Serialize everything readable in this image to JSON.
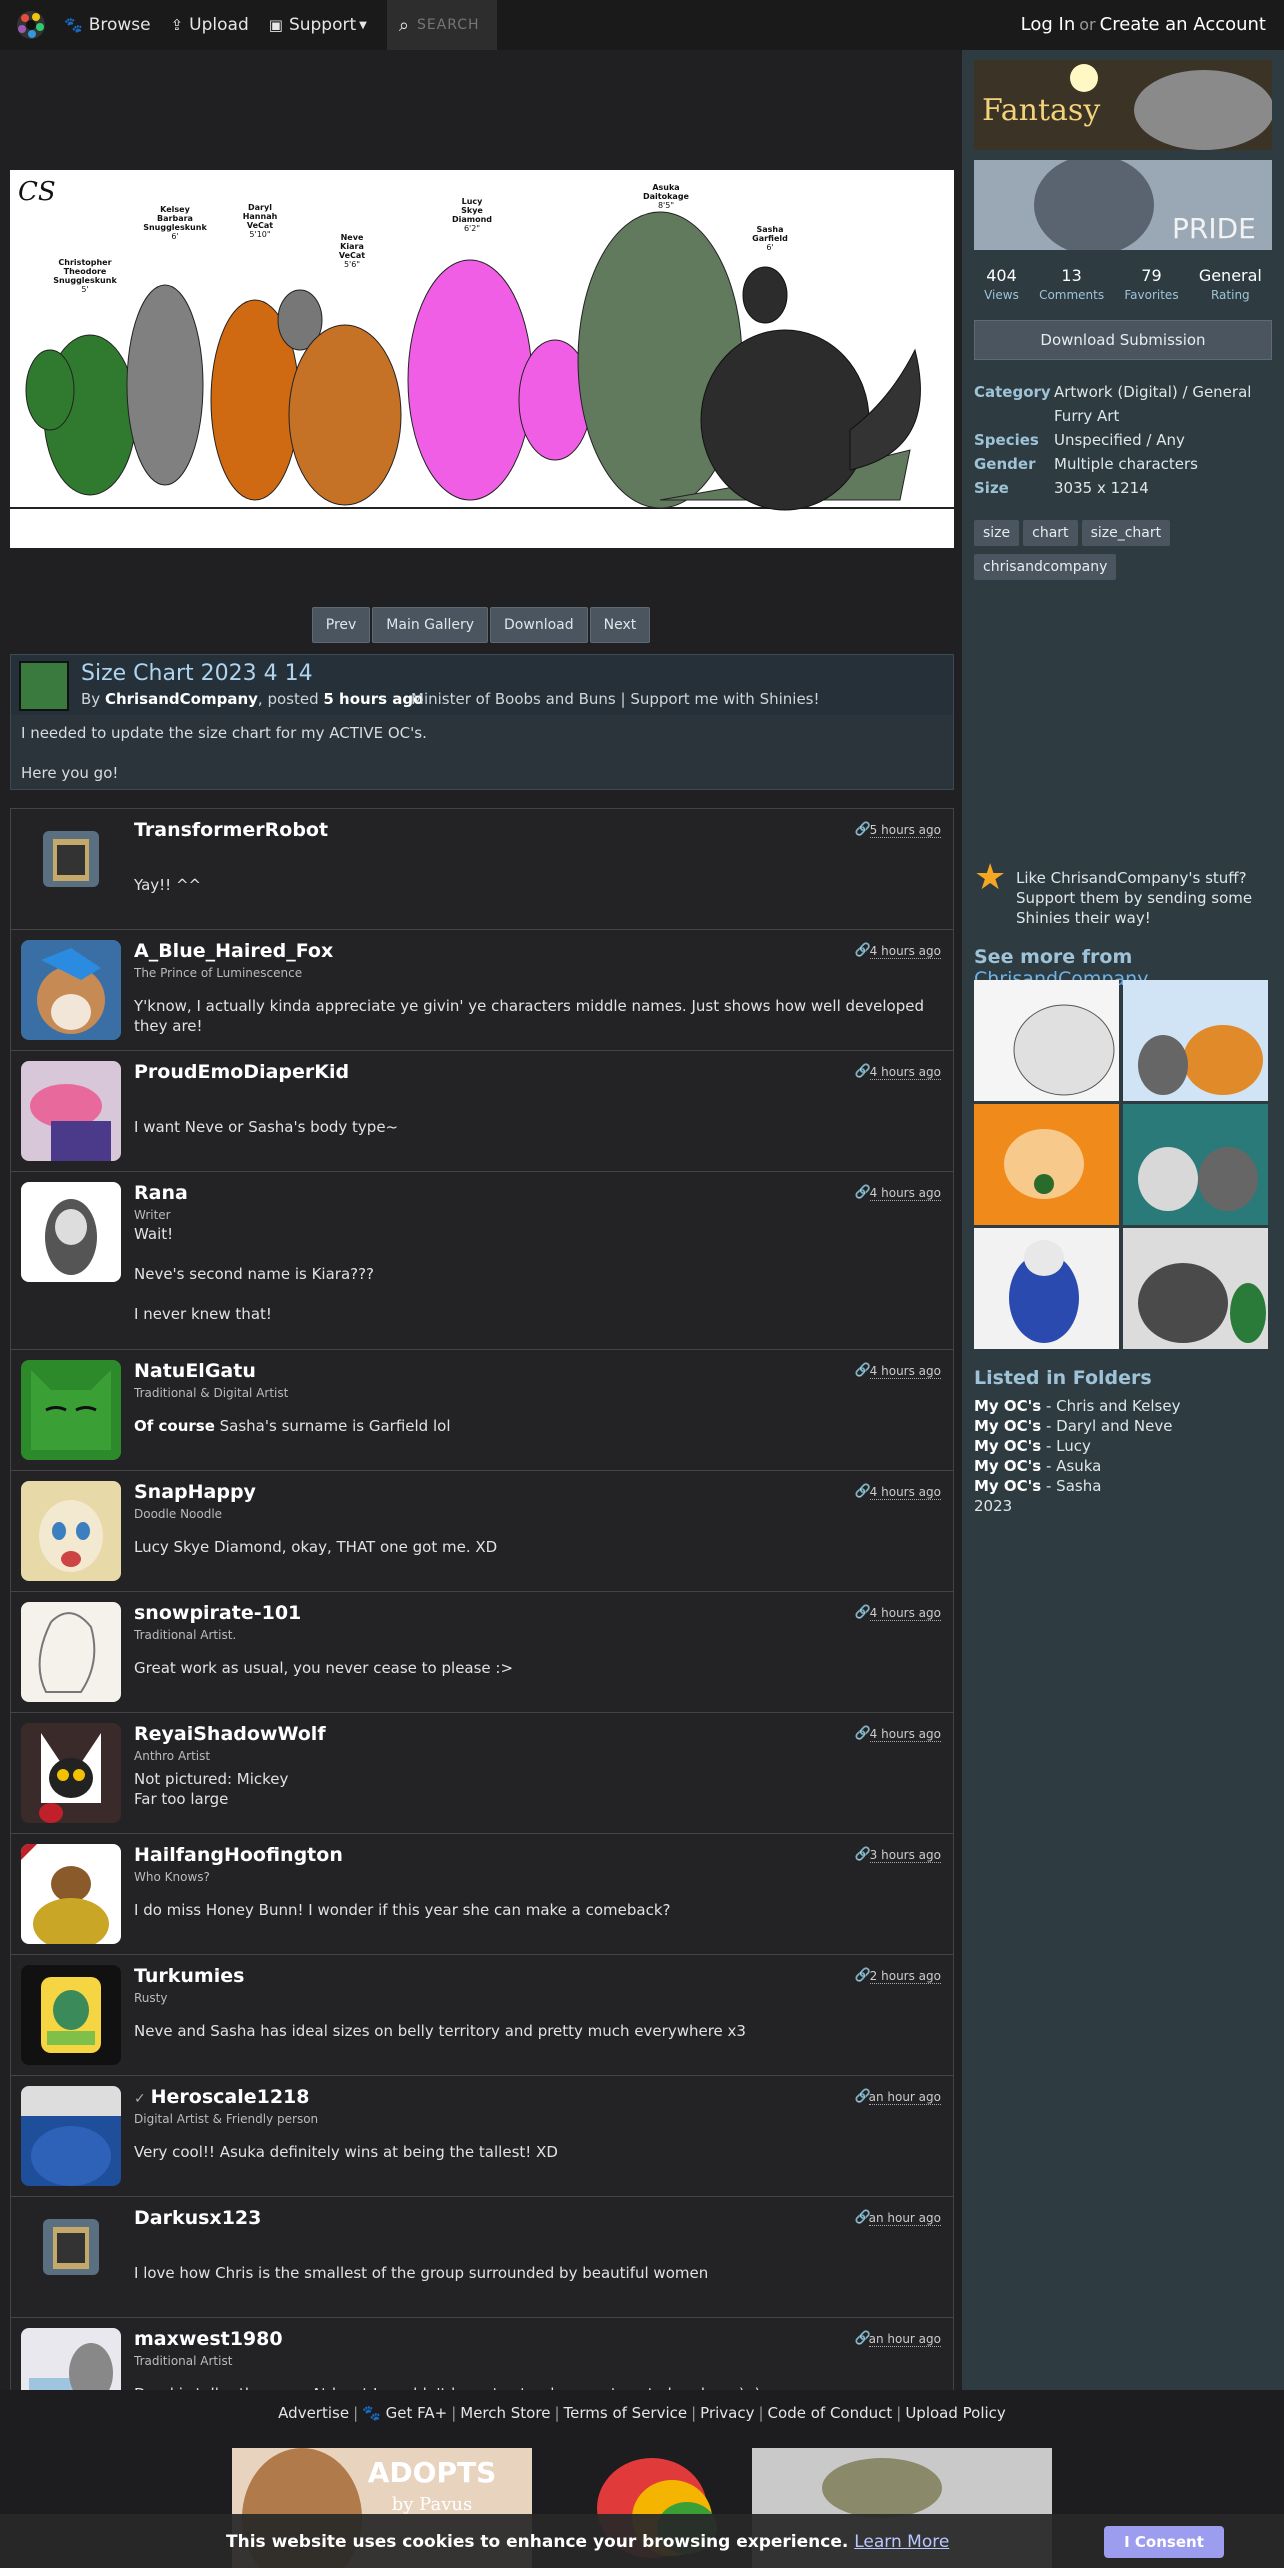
{
  "nav": {
    "browse": "Browse",
    "upload": "Upload",
    "support": "Support",
    "search_placeholder": "SEARCH",
    "login": "Log In",
    "or": "or",
    "create_account": "Create an Account"
  },
  "artwork": {
    "chars": [
      {
        "name": "Christopher\nTheodore\nSnuggleskunk",
        "height": "5'"
      },
      {
        "name": "Kelsey\nBarbara\nSnuggleskunk",
        "height": "6'"
      },
      {
        "name": "Daryl\nHannah\nVeCat",
        "height": "5'10\""
      },
      {
        "name": "Neve\nKiara\nVeCat",
        "height": "5'6\""
      },
      {
        "name": "Lucy\nSkye\nDiamond",
        "height": "6'2\""
      },
      {
        "name": "Asuka\nDaitokage",
        "height": "8'5\""
      },
      {
        "name": "Sasha\nGarfield",
        "height": "6'"
      }
    ]
  },
  "subnav": {
    "prev": "Prev",
    "main_gallery": "Main Gallery",
    "download": "Download",
    "next": "Next"
  },
  "submission": {
    "title": "Size Chart 2023 4 14",
    "by": "By",
    "author": "ChrisandCompany",
    "posted": ", posted",
    "time": "5 hours ago",
    "tagline": "Minister of Boobs and Buns | Support me with Shinies!",
    "desc1": "I needed to update the size chart for my ACTIVE OC's.",
    "desc2": "Here you go!"
  },
  "comments": [
    {
      "name": "TransformerRobot",
      "title": "",
      "time": "5 hours ago",
      "body": "Yay!! ^^"
    },
    {
      "name": "A_Blue_Haired_Fox",
      "title": "The Prince of Luminescence",
      "time": "4 hours ago",
      "body": "Y'know, I actually kinda appreciate ye givin' ye characters middle names. Just shows how well developed they are!"
    },
    {
      "name": "ProudEmoDiaperKid",
      "title": "",
      "time": "4 hours ago",
      "body": "I want Neve or Sasha's body type~"
    },
    {
      "name": "Rana",
      "title": "Writer",
      "time": "4 hours ago",
      "body1": "Wait!",
      "body2": "Neve's second name is Kiara???",
      "body3": "I never knew that!"
    },
    {
      "name": "NatuElGatu",
      "title": "Traditional & Digital Artist",
      "time": "4 hours ago",
      "bold": "Of course",
      "body": " Sasha's surname is Garfield lol"
    },
    {
      "name": "SnapHappy",
      "title": "Doodle Noodle",
      "time": "4 hours ago",
      "body": "Lucy Skye Diamond, okay, THAT one got me. XD"
    },
    {
      "name": "snowpirate-101",
      "title": "Traditional Artist.",
      "time": "4 hours ago",
      "body": "Great work as usual, you never cease to please :>"
    },
    {
      "name": "ReyaiShadowWolf",
      "title": "Anthro Artist",
      "time": "4 hours ago",
      "body1": "Not pictured: Mickey",
      "body2": "Far too large"
    },
    {
      "name": "HailfangHoofington",
      "title": "Who Knows?",
      "time": "3 hours ago",
      "body": "I do miss Honey Bunn! I wonder if this year she can make a comeback?"
    },
    {
      "name": "Turkumies",
      "title": "Rusty",
      "time": "2 hours ago",
      "body": "Neve and Sasha has ideal sizes on belly territory and pretty much everywhere x3"
    },
    {
      "name": "Heroscale1218",
      "title": "Digital Artist & Friendly person",
      "time": "an hour ago",
      "body": "Very cool!! Asuka definitely wins at being the tallest! XD"
    },
    {
      "name": "Darkusx123",
      "title": "",
      "time": "an hour ago",
      "body": "I love how Chris is the smallest of the group surrounded by beautiful women"
    },
    {
      "name": "maxwest1980",
      "title": "Traditional Artist",
      "time": "an hour ago",
      "body": "Daryl is taller than me. At least I wouldn't have to stand on my toes to hug her. :) ;)"
    }
  ],
  "sidebar": {
    "banner1_text": "Fantasy",
    "banner2_text": "PRIDE",
    "stats": [
      {
        "num": "404",
        "label": "Views"
      },
      {
        "num": "13",
        "label": "Comments"
      },
      {
        "num": "79",
        "label": "Favorites"
      },
      {
        "num": "General",
        "label": "Rating"
      }
    ],
    "download": "Download Submission",
    "info": [
      {
        "k": "Category",
        "v": "Artwork (Digital) / General Furry Art"
      },
      {
        "k": "Species",
        "v": "Unspecified / Any"
      },
      {
        "k": "Gender",
        "v": "Multiple characters"
      },
      {
        "k": "Size",
        "v": "3035 x 1214"
      }
    ],
    "tags": [
      "size",
      "chart",
      "size_chart",
      "chrisandcompany"
    ],
    "promo": "Like ChrisandCompany's stuff? Support them by sending some Shinies their way!",
    "see_more": "See more from",
    "see_more_user": "ChrisandCompany",
    "folders_title": "Listed in Folders",
    "folders": [
      {
        "b": "My OC's",
        "t": " - Chris and Kelsey"
      },
      {
        "b": "My OC's",
        "t": " - Daryl and Neve"
      },
      {
        "b": "My OC's",
        "t": " - Lucy"
      },
      {
        "b": "My OC's",
        "t": " - Asuka"
      },
      {
        "b": "My OC's",
        "t": " - Sasha"
      },
      {
        "b": "",
        "t": "2023"
      }
    ]
  },
  "footer": {
    "links": [
      "Advertise",
      "Get FA+",
      "Merch Store",
      "Terms of Service",
      "Privacy",
      "Code of Conduct",
      "Upload Policy"
    ],
    "ad_text1": "ADOPTS",
    "ad_text2": "by Pavus"
  },
  "cookie": {
    "text": "This website uses cookies to enhance your browsing experience.",
    "learn": "Learn More",
    "button": "I Consent"
  }
}
